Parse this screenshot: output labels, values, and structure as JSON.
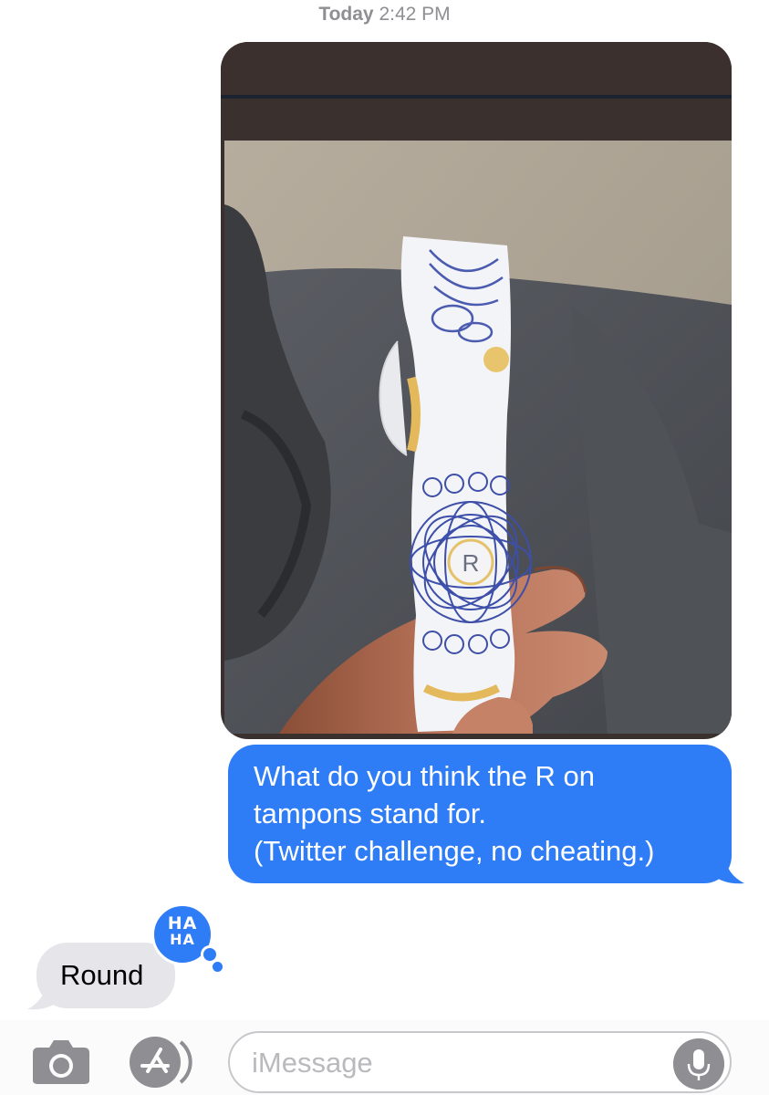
{
  "header": {
    "timestamp_day": "Today",
    "timestamp_time": "2:42 PM"
  },
  "messages": {
    "outgoing_image": {
      "content": "photo of a tampon wrapper printed with an R, held in a hand",
      "wrapper_letter": "R"
    },
    "outgoing_text_lines": [
      "What do you think the R on",
      "tampons stand for.",
      "(Twitter challenge, no cheating.)"
    ],
    "incoming_text": "Round",
    "tapback": {
      "line1": "HA",
      "line2": "HA"
    }
  },
  "input_bar": {
    "placeholder": "iMessage",
    "icons": [
      "camera-icon",
      "app-store-icon",
      "microphone-icon"
    ]
  },
  "colors": {
    "outgoing_bubble": "#2e7cf6",
    "incoming_bubble": "#e5e5ea",
    "timestamp": "#8e8e93",
    "placeholder": "#b9b9be",
    "image_frame": "#3a302e"
  }
}
